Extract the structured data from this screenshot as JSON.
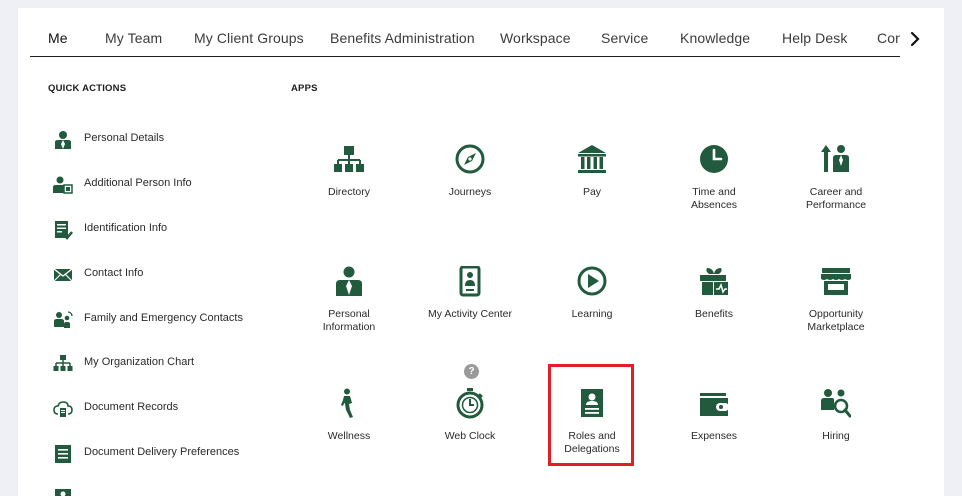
{
  "colors": {
    "icon": "#215a3c",
    "highlight": "#e41e26"
  },
  "nav": {
    "tabs": [
      "Me",
      "My Team",
      "My Client Groups",
      "Benefits Administration",
      "Workspace",
      "Service",
      "Knowledge",
      "Help Desk",
      "Con"
    ],
    "active": "Me",
    "next_icon": "chevron-right-icon"
  },
  "quick_actions": {
    "title": "QUICK ACTIONS",
    "items": [
      {
        "label": "Personal Details",
        "icon": "person-icon"
      },
      {
        "label": "Additional Person Info",
        "icon": "person-card-icon"
      },
      {
        "label": "Identification Info",
        "icon": "id-document-icon"
      },
      {
        "label": "Contact Info",
        "icon": "envelope-icon"
      },
      {
        "label": "Family and Emergency Contacts",
        "icon": "family-icon"
      },
      {
        "label": "My Organization Chart",
        "icon": "org-chart-icon"
      },
      {
        "label": "Document Records",
        "icon": "document-records-icon"
      },
      {
        "label": "Document Delivery Preferences",
        "icon": "document-delivery-icon"
      }
    ]
  },
  "apps": {
    "title": "APPS",
    "help_badge": "?",
    "items": [
      {
        "label": "Directory",
        "icon": "directory-icon"
      },
      {
        "label": "Journeys",
        "icon": "compass-icon"
      },
      {
        "label": "Pay",
        "icon": "bank-icon"
      },
      {
        "label": "Time and\nAbsences",
        "icon": "clock-icon"
      },
      {
        "label": "Career and\nPerformance",
        "icon": "career-icon"
      },
      {
        "label": "Personal\nInformation",
        "icon": "personal-info-icon"
      },
      {
        "label": "My Activity Center",
        "icon": "activity-center-icon"
      },
      {
        "label": "Learning",
        "icon": "play-circle-icon"
      },
      {
        "label": "Benefits",
        "icon": "gift-icon"
      },
      {
        "label": "Opportunity\nMarketplace",
        "icon": "storefront-icon"
      },
      {
        "label": "Wellness",
        "icon": "wellness-icon"
      },
      {
        "label": "Web Clock",
        "icon": "stopwatch-icon"
      },
      {
        "label": "Roles and\nDelegations",
        "icon": "roles-badge-icon"
      },
      {
        "label": "Expenses",
        "icon": "wallet-icon"
      },
      {
        "label": "Hiring",
        "icon": "hiring-icon"
      }
    ]
  }
}
